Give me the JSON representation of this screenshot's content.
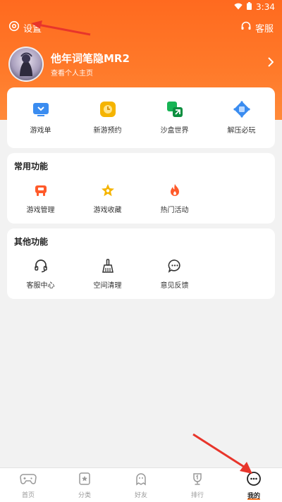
{
  "status_bar": {
    "time": "3:34"
  },
  "top_bar": {
    "settings_label": "设置",
    "service_label": "客服"
  },
  "profile": {
    "nickname": "他年词笔隐MR2",
    "subtitle": "查看个人主页"
  },
  "quick_entries": [
    {
      "label": "游戏单",
      "icon": "game-list-icon",
      "color": "#3a8cf0"
    },
    {
      "label": "新游预约",
      "icon": "clock-icon",
      "color": "#f5b400"
    },
    {
      "label": "沙盒世界",
      "icon": "sandbox-icon",
      "color": "#17b455"
    },
    {
      "label": "解压必玩",
      "icon": "cube-icon",
      "color": "#3a8cf0"
    }
  ],
  "common_functions": {
    "title": "常用功能",
    "items": [
      {
        "label": "游戏管理",
        "icon": "gamepad-icon",
        "color": "#ff5a2a"
      },
      {
        "label": "游戏收藏",
        "icon": "star-icon",
        "color": "#f5b400"
      },
      {
        "label": "热门活动",
        "icon": "fire-icon",
        "color": "#ff5a2a"
      }
    ]
  },
  "other_functions": {
    "title": "其他功能",
    "items": [
      {
        "label": "客服中心",
        "icon": "headset-icon"
      },
      {
        "label": "空间清理",
        "icon": "broom-icon"
      },
      {
        "label": "意见反馈",
        "icon": "chat-bubble-icon"
      }
    ]
  },
  "tab_bar": {
    "active": "我的",
    "tabs": [
      {
        "label": "首页",
        "icon": "gamepad-icon"
      },
      {
        "label": "分类",
        "icon": "category-icon"
      },
      {
        "label": "好友",
        "icon": "ghost-icon"
      },
      {
        "label": "排行",
        "icon": "rank-icon"
      },
      {
        "label": "我的",
        "icon": "me-icon"
      }
    ]
  },
  "colors": {
    "accent": "#ff7a2a",
    "annotation_arrow": "#e8352b"
  }
}
